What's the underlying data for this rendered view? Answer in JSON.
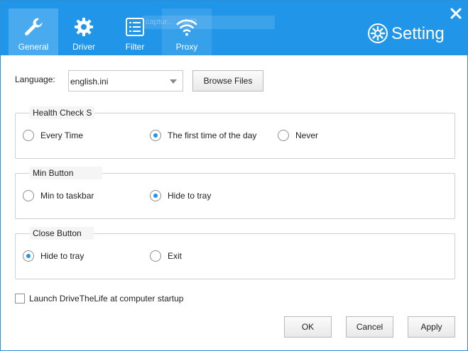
{
  "tabs": [
    {
      "label": "General",
      "icon": "wrench-icon",
      "active": true
    },
    {
      "label": "Driver",
      "icon": "gear-icon"
    },
    {
      "label": "Filter",
      "icon": "list-icon"
    },
    {
      "label": "Proxy",
      "icon": "wifi-icon"
    }
  ],
  "header": {
    "ghost_text": "captur... ...del?",
    "brand_title": "Setting",
    "accent_color": "#2196e8"
  },
  "language": {
    "label": "Language:",
    "selected": "english.ini",
    "browse_label": "Browse Files"
  },
  "health_check": {
    "title": "Health Check S",
    "options": [
      "Every Time",
      "The first time of the day",
      "Never"
    ],
    "selected_index": 1
  },
  "min_button": {
    "title": "Min Button",
    "options": [
      "Min to taskbar",
      "Hide to tray"
    ],
    "selected_index": 1
  },
  "close_button": {
    "title": "Close Button",
    "options": [
      "Hide to tray",
      "Exit"
    ],
    "selected_index": 0
  },
  "startup": {
    "label": "Launch DriveTheLife at computer startup",
    "checked": false
  },
  "footer": {
    "ok": "OK",
    "cancel": "Cancel",
    "apply": "Apply"
  }
}
